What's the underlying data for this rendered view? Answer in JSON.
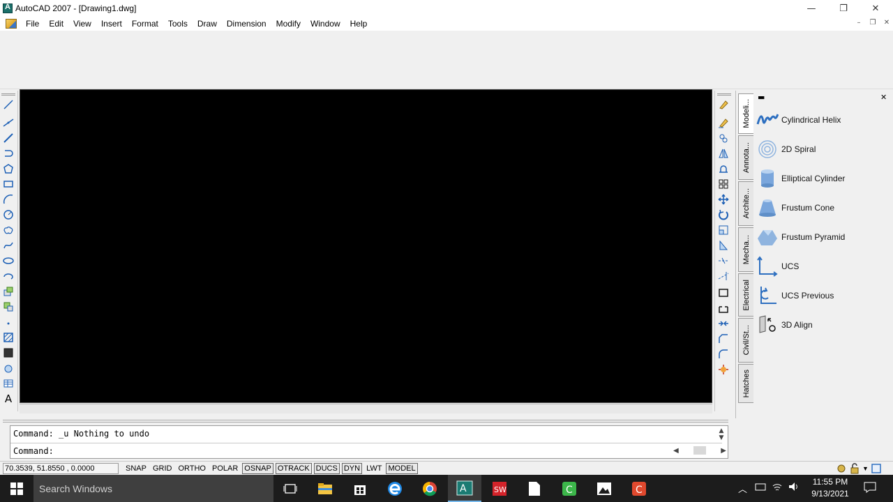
{
  "titlebar": {
    "title": "AutoCAD 2007 - [Drawing1.dwg]"
  },
  "window_controls": {
    "minimize": "—",
    "restore": "❐",
    "close": "✕"
  },
  "mdi_controls": {
    "minimize": "–",
    "restore": "❐",
    "close": "✕"
  },
  "menu": [
    "File",
    "Edit",
    "View",
    "Insert",
    "Format",
    "Tools",
    "Draw",
    "Dimension",
    "Modify",
    "Window",
    "Help"
  ],
  "palette": {
    "tabs": [
      "Modeli...",
      "Annota...",
      "Archite...",
      "Mecha...",
      "Electrical",
      "Civil/St...",
      "Hatches"
    ],
    "active_tab": "Modeli...",
    "items": [
      {
        "label": "Cylindrical Helix",
        "icon": "helix-icon"
      },
      {
        "label": "2D Spiral",
        "icon": "spiral-icon"
      },
      {
        "label": "Elliptical Cylinder",
        "icon": "cylinder-icon"
      },
      {
        "label": "Frustum Cone",
        "icon": "cone-icon"
      },
      {
        "label": "Frustum Pyramid",
        "icon": "pyramid-icon"
      },
      {
        "label": "UCS",
        "icon": "ucs-icon"
      },
      {
        "label": "UCS Previous",
        "icon": "ucs-previous-icon"
      },
      {
        "label": "3D Align",
        "icon": "3d-align-icon"
      }
    ],
    "close": "✕",
    "minimize": "▬"
  },
  "command": {
    "history": "Command: _u Nothing to undo",
    "prompt": "Command:"
  },
  "status": {
    "coords": "70.3539, 51.8550 , 0.0000",
    "buttons": [
      {
        "label": "SNAP",
        "on": false
      },
      {
        "label": "GRID",
        "on": false
      },
      {
        "label": "ORTHO",
        "on": false
      },
      {
        "label": "POLAR",
        "on": false
      },
      {
        "label": "OSNAP",
        "on": true
      },
      {
        "label": "OTRACK",
        "on": true
      },
      {
        "label": "DUCS",
        "on": true
      },
      {
        "label": "DYN",
        "on": true
      },
      {
        "label": "LWT",
        "on": false
      },
      {
        "label": "MODEL",
        "on": true
      }
    ]
  },
  "taskbar": {
    "search_placeholder": "Search Windows",
    "time": "11:55 PM",
    "date": "9/13/2021"
  },
  "colors": {
    "canvas": "#000000",
    "taskbar": "#1c1c1c",
    "accent": "#76b9ed"
  }
}
